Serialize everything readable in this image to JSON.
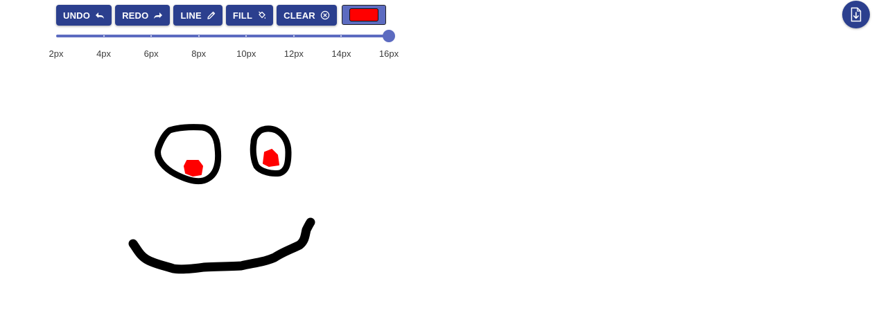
{
  "toolbar": {
    "buttons": [
      {
        "label": "UNDO",
        "icon": "undo-icon"
      },
      {
        "label": "REDO",
        "icon": "redo-icon"
      },
      {
        "label": "LINE",
        "icon": "pencil-icon"
      },
      {
        "label": "FILL",
        "icon": "paint-bucket-icon"
      },
      {
        "label": "CLEAR",
        "icon": "clear-circle-icon"
      }
    ],
    "current_color": "#ff0000"
  },
  "brush_size": {
    "options": [
      "2px",
      "4px",
      "6px",
      "8px",
      "10px",
      "12px",
      "14px",
      "16px"
    ],
    "selected": "16px"
  },
  "download": {
    "icon": "download-file-icon"
  },
  "colors": {
    "accent": "#2b3f8e",
    "slider": "#5c6bc0",
    "stroke_black": "#000000",
    "stroke_red": "#ff0000"
  }
}
